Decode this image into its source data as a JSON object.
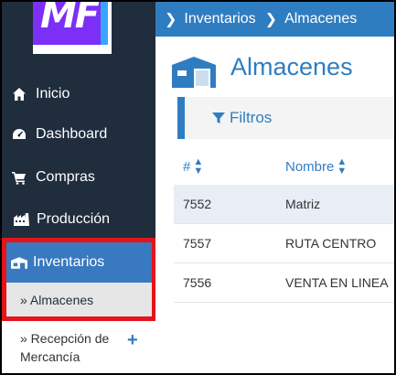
{
  "logo": {
    "text": "MF"
  },
  "sidebar": {
    "items": [
      {
        "label": "Inicio",
        "icon": "home-icon"
      },
      {
        "label": "Dashboard",
        "icon": "dashboard-icon"
      },
      {
        "label": "Compras",
        "icon": "cart-icon"
      },
      {
        "label": "Producción",
        "icon": "factory-icon"
      },
      {
        "label": "Inventarios",
        "icon": "warehouse-icon"
      }
    ],
    "subitems": [
      {
        "label": "» Almacenes"
      },
      {
        "label_line1": "» Recepción de",
        "label_line2": "Mercancía",
        "action": "+"
      }
    ]
  },
  "breadcrumb": {
    "items": [
      "Inventarios",
      "Almacenes"
    ]
  },
  "page": {
    "title": "Almacenes"
  },
  "filter": {
    "label": "Filtros"
  },
  "table": {
    "columns": [
      "#",
      "Nombre"
    ],
    "rows": [
      {
        "id": "7552",
        "name": "Matriz"
      },
      {
        "id": "7557",
        "name": "RUTA CENTRO"
      },
      {
        "id": "7556",
        "name": "VENTA EN LINEA"
      }
    ]
  },
  "colors": {
    "sidebar": "#1f2d3d",
    "accent": "#2f7dc1",
    "active": "#3979bf",
    "highlight": "#e3141b"
  }
}
